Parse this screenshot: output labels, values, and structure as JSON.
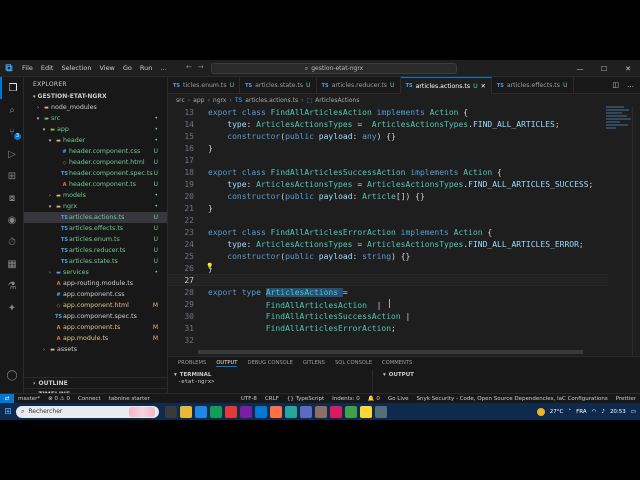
{
  "titlebar": {
    "menu": [
      "File",
      "Edit",
      "Selection",
      "View",
      "Go",
      "Run",
      "…"
    ],
    "search": "gestion-etat-ngrx"
  },
  "sidebar": {
    "header": "EXPLORER",
    "project": "GESTION-ETAT-NGRX",
    "tree": [
      {
        "label": "node_modules",
        "kind": "folder",
        "depth": 1,
        "open": false,
        "badge": ""
      },
      {
        "label": "src",
        "kind": "folder-green",
        "depth": 1,
        "open": true,
        "badge": "•"
      },
      {
        "label": "app",
        "kind": "folder-green",
        "depth": 2,
        "open": true,
        "badge": "•"
      },
      {
        "label": "header",
        "kind": "folder",
        "depth": 3,
        "open": true,
        "badge": "•"
      },
      {
        "label": "header.component.css",
        "kind": "css",
        "depth": 4,
        "open": null,
        "badge": "U"
      },
      {
        "label": "header.component.html",
        "kind": "html",
        "depth": 4,
        "open": null,
        "badge": "U"
      },
      {
        "label": "header.component.spec.ts",
        "kind": "spec",
        "depth": 4,
        "open": null,
        "badge": "U"
      },
      {
        "label": "header.component.ts",
        "kind": "ts-angular",
        "depth": 4,
        "open": null,
        "badge": "U"
      },
      {
        "label": "models",
        "kind": "folder",
        "depth": 3,
        "open": false,
        "badge": "•"
      },
      {
        "label": "ngrx",
        "kind": "folder",
        "depth": 3,
        "open": true,
        "badge": "•"
      },
      {
        "label": "articles.actions.ts",
        "kind": "ts",
        "depth": 4,
        "open": null,
        "badge": "U",
        "selected": true
      },
      {
        "label": "articles.effects.ts",
        "kind": "ts",
        "depth": 4,
        "open": null,
        "badge": "U"
      },
      {
        "label": "articles.enum.ts",
        "kind": "ts",
        "depth": 4,
        "open": null,
        "badge": "U"
      },
      {
        "label": "articles.reducer.ts",
        "kind": "ts",
        "depth": 4,
        "open": null,
        "badge": "U"
      },
      {
        "label": "articles.state.ts",
        "kind": "ts",
        "depth": 4,
        "open": null,
        "badge": "U"
      },
      {
        "label": "services",
        "kind": "folder-blue",
        "depth": 3,
        "open": false,
        "badge": "•"
      },
      {
        "label": "app-routing.module.ts",
        "kind": "ts-angular",
        "depth": 3,
        "open": null,
        "badge": ""
      },
      {
        "label": "app.component.css",
        "kind": "css",
        "depth": 3,
        "open": null,
        "badge": ""
      },
      {
        "label": "app.component.html",
        "kind": "html",
        "depth": 3,
        "open": null,
        "badge": "M"
      },
      {
        "label": "app.component.spec.ts",
        "kind": "spec",
        "depth": 3,
        "open": null,
        "badge": ""
      },
      {
        "label": "app.component.ts",
        "kind": "ts-angular",
        "depth": 3,
        "open": null,
        "badge": "M"
      },
      {
        "label": "app.module.ts",
        "kind": "ts-angular",
        "depth": 3,
        "open": null,
        "badge": "M"
      },
      {
        "label": "assets",
        "kind": "folder",
        "depth": 2,
        "open": false,
        "badge": ""
      }
    ],
    "bottom_sections": [
      "OUTLINE",
      "TIMELINE",
      "LOCAL HISTORY"
    ]
  },
  "tabs": [
    {
      "label": "ticles.enum.ts",
      "status": "U",
      "active": false
    },
    {
      "label": "articles.state.ts",
      "status": "U",
      "active": false
    },
    {
      "label": "articles.reducer.ts",
      "status": "U",
      "active": false
    },
    {
      "label": "articles.actions.ts",
      "status": "U",
      "active": true
    },
    {
      "label": "articles.effects.ts",
      "status": "U",
      "active": false
    }
  ],
  "breadcrumb": [
    "src",
    "app",
    "ngrx",
    "articles.actions.ts",
    "ArticlesActions"
  ],
  "editor": {
    "lines": [
      {
        "n": "13",
        "tokens": [
          [
            "k",
            "export "
          ],
          [
            "k",
            "class "
          ],
          [
            "cls",
            "FindAllArticlesAction "
          ],
          [
            "k",
            "implements "
          ],
          [
            "cls",
            "Action "
          ],
          [
            "p",
            "{"
          ]
        ]
      },
      {
        "n": "14",
        "tokens": [
          [
            "ind",
            "    "
          ],
          [
            "prop",
            "type"
          ],
          [
            "p",
            ": "
          ],
          [
            "cls",
            "ArticlesActionsTypes "
          ],
          [
            "p",
            "=  "
          ],
          [
            "cls",
            "ArticlesActionsTypes"
          ],
          [
            "p",
            "."
          ],
          [
            "prop",
            "FIND_ALL_ARTICLES"
          ],
          [
            "p",
            ";"
          ]
        ]
      },
      {
        "n": "15",
        "tokens": [
          [
            "ind",
            "    "
          ],
          [
            "k",
            "constructor"
          ],
          [
            "p",
            "("
          ],
          [
            "k",
            "public "
          ],
          [
            "prop",
            "payload"
          ],
          [
            "p",
            ": "
          ],
          [
            "k",
            "any"
          ],
          [
            "p",
            ") {}"
          ]
        ]
      },
      {
        "n": "16",
        "tokens": [
          [
            "p",
            "}"
          ]
        ]
      },
      {
        "n": "17",
        "tokens": []
      },
      {
        "n": "18",
        "tokens": [
          [
            "k",
            "export "
          ],
          [
            "k",
            "class "
          ],
          [
            "cls",
            "FindAllArticlesSuccessAction "
          ],
          [
            "k",
            "implements "
          ],
          [
            "cls",
            "Action "
          ],
          [
            "p",
            "{"
          ]
        ]
      },
      {
        "n": "19",
        "tokens": [
          [
            "ind",
            "    "
          ],
          [
            "prop",
            "type"
          ],
          [
            "p",
            ": "
          ],
          [
            "cls",
            "ArticlesActionsTypes "
          ],
          [
            "p",
            "= "
          ],
          [
            "cls",
            "ArticlesActionsTypes"
          ],
          [
            "p",
            "."
          ],
          [
            "prop",
            "FIND_ALL_ARTICLES_SUCCESS"
          ],
          [
            "p",
            ";"
          ]
        ]
      },
      {
        "n": "20",
        "tokens": [
          [
            "ind",
            "    "
          ],
          [
            "k",
            "constructor"
          ],
          [
            "p",
            "("
          ],
          [
            "k",
            "public "
          ],
          [
            "prop",
            "payload"
          ],
          [
            "p",
            ": "
          ],
          [
            "cls",
            "Article"
          ],
          [
            "p",
            "[]) {}"
          ]
        ]
      },
      {
        "n": "21",
        "tokens": [
          [
            "p",
            "}"
          ]
        ]
      },
      {
        "n": "22",
        "tokens": []
      },
      {
        "n": "23",
        "tokens": [
          [
            "k",
            "export "
          ],
          [
            "k",
            "class "
          ],
          [
            "cls",
            "FindAllArticlesErrorAction "
          ],
          [
            "k",
            "implements "
          ],
          [
            "cls",
            "Action "
          ],
          [
            "p",
            "{"
          ]
        ]
      },
      {
        "n": "24",
        "tokens": [
          [
            "ind",
            "    "
          ],
          [
            "prop",
            "type"
          ],
          [
            "p",
            ": "
          ],
          [
            "cls",
            "ArticlesActionsTypes "
          ],
          [
            "p",
            "= "
          ],
          [
            "cls",
            "ArticlesActionsTypes"
          ],
          [
            "p",
            "."
          ],
          [
            "prop",
            "FIND_ALL_ARTICLES_ERROR"
          ],
          [
            "p",
            ";"
          ]
        ]
      },
      {
        "n": "25",
        "tokens": [
          [
            "ind",
            "    "
          ],
          [
            "k",
            "constructor"
          ],
          [
            "p",
            "("
          ],
          [
            "k",
            "public "
          ],
          [
            "prop",
            "payload"
          ],
          [
            "p",
            ": "
          ],
          [
            "k",
            "string"
          ],
          [
            "p",
            ") {}"
          ]
        ]
      },
      {
        "n": "26",
        "tokens": [
          [
            "p",
            "}"
          ]
        ]
      },
      {
        "n": "27",
        "tokens": []
      },
      {
        "n": "28",
        "tokens": [
          [
            "k",
            "export "
          ],
          [
            "k",
            "type "
          ],
          [
            "hl",
            "ArticlesActions "
          ],
          [
            "p",
            "="
          ]
        ]
      },
      {
        "n": "29",
        "tokens": [
          [
            "ind",
            "            "
          ],
          [
            "cls",
            "FindAllArticlesAction"
          ],
          [
            "p",
            "  |"
          ]
        ]
      },
      {
        "n": "30",
        "tokens": [
          [
            "ind",
            "            "
          ],
          [
            "cls",
            "FindAllArticlesSuccessAction"
          ],
          [
            "p",
            " |"
          ]
        ]
      },
      {
        "n": "31",
        "tokens": [
          [
            "ind",
            "            "
          ],
          [
            "cls",
            "FindAllArticlesErrorAction"
          ],
          [
            "p",
            ";"
          ]
        ]
      },
      {
        "n": "32",
        "tokens": []
      }
    ]
  },
  "panel": {
    "tabs": [
      "PROBLEMS",
      "OUTPUT",
      "DEBUG CONSOLE",
      "GITLENS",
      "SQL CONSOLE",
      "COMMENTS"
    ],
    "active_tab": "OUTPUT",
    "left_title": "TERMINAL",
    "left_line": "-etat-ngrx>",
    "right_title": "OUTPUT"
  },
  "statusbar": {
    "left": [
      "master*",
      "⊗ 0 ⚠ 0",
      "Connect",
      "tabnine starter"
    ],
    "right": [
      "UTF-8",
      "CRLF",
      "{} TypeScript",
      "Indents: 0",
      "🔔 0",
      "Go Live",
      "Snyk Security - Code, Open Source Dependencies, IaC Configurations",
      "Prettier"
    ]
  },
  "taskbar": {
    "search_placeholder": "Rechercher",
    "temperature": "27°C",
    "language": "FRA",
    "time": "20:53"
  }
}
